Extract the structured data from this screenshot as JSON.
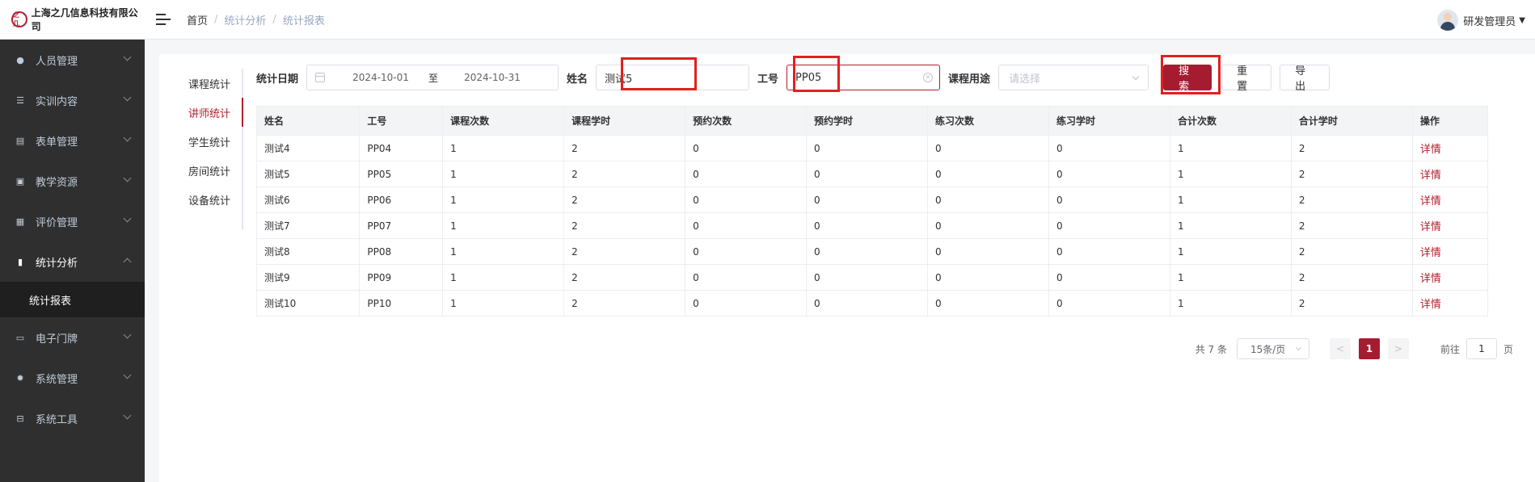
{
  "app": {
    "logo_mark": "之几",
    "company_name": "上海之几信息科技有限公司"
  },
  "breadcrumb": [
    "首页",
    "统计分析",
    "统计报表"
  ],
  "user": {
    "name": "研发管理员"
  },
  "sidebar": {
    "items": [
      {
        "label": "人员管理",
        "icon": "person-icon"
      },
      {
        "label": "实训内容",
        "icon": "list-icon"
      },
      {
        "label": "表单管理",
        "icon": "form-icon"
      },
      {
        "label": "教学资源",
        "icon": "book-icon"
      },
      {
        "label": "评价管理",
        "icon": "rating-icon"
      },
      {
        "label": "统计分析",
        "icon": "bar-chart-icon",
        "expanded": true
      },
      {
        "label": "电子门牌",
        "icon": "monitor-icon"
      },
      {
        "label": "系统管理",
        "icon": "gear-icon"
      },
      {
        "label": "系统工具",
        "icon": "toolbox-icon"
      }
    ],
    "sub_item": "统计报表"
  },
  "tabs": [
    "课程统计",
    "讲师统计",
    "学生统计",
    "房间统计",
    "设备统计"
  ],
  "filter": {
    "date_label": "统计日期",
    "date_start": "2024-10-01",
    "date_sep": "至",
    "date_end": "2024-10-31",
    "name_label": "姓名",
    "name_value": "测试5",
    "id_label": "工号",
    "id_value": "PP05",
    "purpose_label": "课程用途",
    "purpose_placeholder": "请选择",
    "search": "搜索",
    "reset": "重置",
    "export": "导出"
  },
  "table": {
    "headers": [
      "姓名",
      "工号",
      "课程次数",
      "课程学时",
      "预约次数",
      "预约学时",
      "练习次数",
      "练习学时",
      "合计次数",
      "合计学时",
      "操作"
    ],
    "rows": [
      [
        "测试4",
        "PP04",
        "1",
        "2",
        "0",
        "0",
        "0",
        "0",
        "1",
        "2",
        "详情"
      ],
      [
        "测试5",
        "PP05",
        "1",
        "2",
        "0",
        "0",
        "0",
        "0",
        "1",
        "2",
        "详情"
      ],
      [
        "测试6",
        "PP06",
        "1",
        "2",
        "0",
        "0",
        "0",
        "0",
        "1",
        "2",
        "详情"
      ],
      [
        "测试7",
        "PP07",
        "1",
        "2",
        "0",
        "0",
        "0",
        "0",
        "1",
        "2",
        "详情"
      ],
      [
        "测试8",
        "PP08",
        "1",
        "2",
        "0",
        "0",
        "0",
        "0",
        "1",
        "2",
        "详情"
      ],
      [
        "测试9",
        "PP09",
        "1",
        "2",
        "0",
        "0",
        "0",
        "0",
        "1",
        "2",
        "详情"
      ],
      [
        "测试10",
        "PP10",
        "1",
        "2",
        "0",
        "0",
        "0",
        "0",
        "1",
        "2",
        "详情"
      ]
    ]
  },
  "pagination": {
    "total": "共 7 条",
    "page_size": "15条/页",
    "prev": "<",
    "current": "1",
    "next": ">",
    "goto_label": "前往",
    "goto_value": "1",
    "goto_suffix": "页"
  },
  "colors": {
    "brand": "#a51c30",
    "sidebar_bg": "#2f2f2f",
    "highlight": "#e02020"
  }
}
